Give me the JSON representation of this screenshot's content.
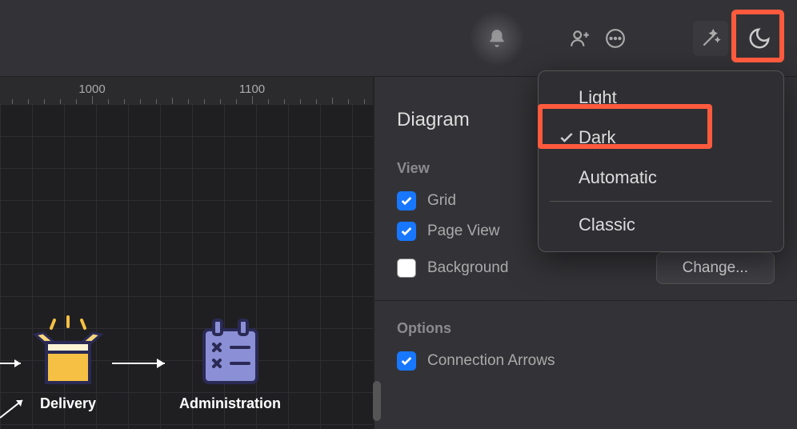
{
  "toolbar": {
    "icons": {
      "bell": "bell-icon",
      "add_user": "person-add-icon",
      "more": "more-icon",
      "magic": "magic-wand-icon",
      "theme": "moon-icon"
    }
  },
  "ruler": {
    "labels": [
      "1000",
      "1100"
    ],
    "positions": [
      115,
      315
    ]
  },
  "nodes": {
    "delivery": {
      "label": "Delivery"
    },
    "administration": {
      "label": "Administration"
    }
  },
  "panel": {
    "title": "Diagram",
    "view": {
      "header": "View",
      "grid": {
        "label": "Grid",
        "checked": true
      },
      "page_view": {
        "label": "Page View",
        "checked": true
      },
      "background": {
        "label": "Background",
        "checked": false,
        "button": "Change..."
      }
    },
    "options": {
      "header": "Options",
      "connection_arrows": {
        "label": "Connection Arrows",
        "checked": true
      }
    }
  },
  "theme_menu": {
    "items": [
      {
        "label": "Light",
        "checked": false
      },
      {
        "label": "Dark",
        "checked": true
      },
      {
        "label": "Automatic",
        "checked": false
      }
    ],
    "secondary": [
      {
        "label": "Classic"
      }
    ]
  },
  "colors": {
    "highlight": "#ff5a3d",
    "accent": "#1877ff"
  }
}
